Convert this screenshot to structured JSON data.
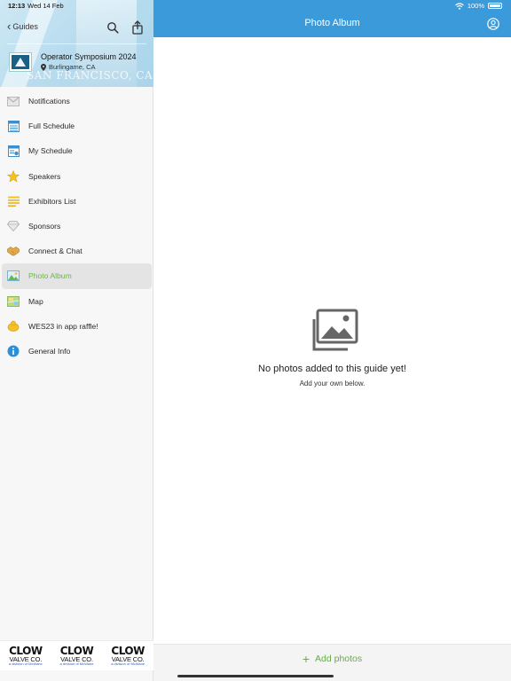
{
  "status_bar": {
    "time": "12:13",
    "date": "Wed 14 Feb",
    "battery": "100%"
  },
  "sidebar": {
    "back_label": "Guides",
    "hero_watermark": "SAN FRANCISCO, CA",
    "guide_title": "Operator Symposium 2024",
    "guide_location": "Burlingame, CA",
    "items": [
      {
        "label": "Notifications",
        "icon": "envelope-icon"
      },
      {
        "label": "Full Schedule",
        "icon": "calendar-icon"
      },
      {
        "label": "My Schedule",
        "icon": "calendar-check-icon"
      },
      {
        "label": "Speakers",
        "icon": "star-icon"
      },
      {
        "label": "Exhibitors List",
        "icon": "list-icon"
      },
      {
        "label": "Sponsors",
        "icon": "diamond-icon"
      },
      {
        "label": "Connect & Chat",
        "icon": "handshake-icon"
      },
      {
        "label": "Photo Album",
        "icon": "photo-icon",
        "active": true
      },
      {
        "label": "Map",
        "icon": "map-icon"
      },
      {
        "label": "WES23 in app raffle!",
        "icon": "raffle-icon"
      },
      {
        "label": "General Info",
        "icon": "info-icon"
      }
    ],
    "sponsors": [
      {
        "name": "CLOW",
        "sub": "VALVE CO.",
        "tag": "a division of McWane"
      },
      {
        "name": "CLOW",
        "sub": "VALVE CO.",
        "tag": "a division of McWane"
      },
      {
        "name": "CLOW",
        "sub": "VALVE CO.",
        "tag": "a division of McWane"
      }
    ]
  },
  "main": {
    "title": "Photo Album",
    "empty_title": "No photos added to this guide yet!",
    "empty_subtitle": "Add your own below.",
    "add_label": "Add photos"
  },
  "colors": {
    "accent_blue": "#3b9ad9",
    "accent_green": "#5fb33a",
    "brand_red": "#d9262b"
  }
}
